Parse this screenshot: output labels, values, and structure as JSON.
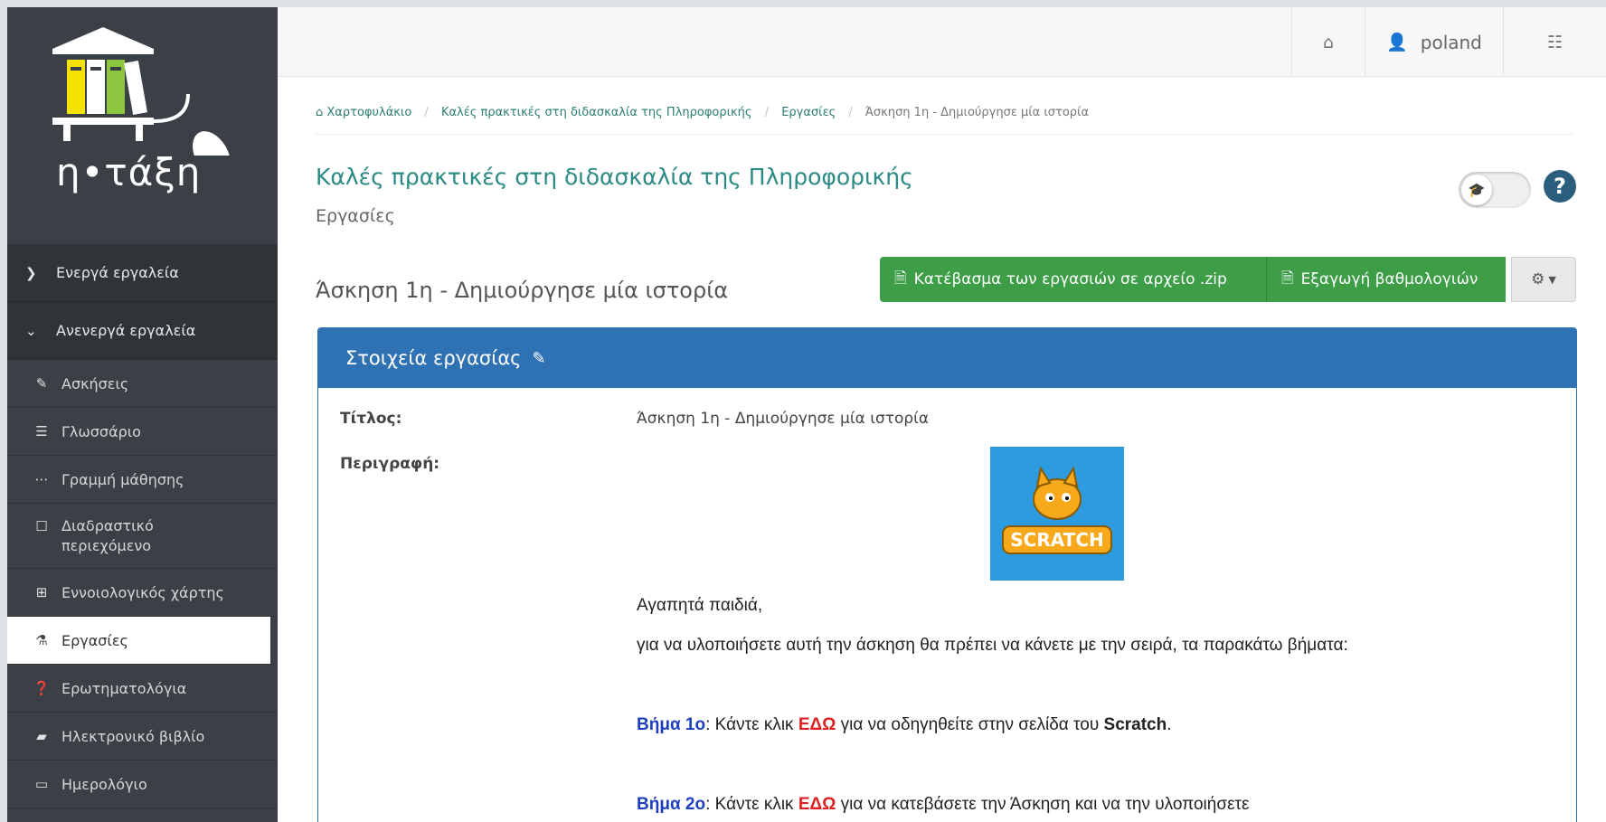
{
  "sidebar": {
    "logo_text": "η•τάξη",
    "active_tools": "Ενεργά εργαλεία",
    "inactive_tools": "Ανενεργά εργαλεία",
    "items": [
      {
        "label": "Ασκήσεις",
        "icon": "edit-icon"
      },
      {
        "label": "Γλωσσάριο",
        "icon": "list-icon"
      },
      {
        "label": "Γραμμή μάθησης",
        "icon": "ellipsis-icon"
      },
      {
        "label": "Διαδραστικό περιεχόμενο",
        "icon": "square-icon"
      },
      {
        "label": "Εννοιολογικός χάρτης",
        "icon": "sitemap-icon"
      },
      {
        "label": "Εργασίες",
        "icon": "flask-icon",
        "active": true
      },
      {
        "label": "Ερωτηματολόγια",
        "icon": "question-icon"
      },
      {
        "label": "Ηλεκτρονικό βιβλίο",
        "icon": "book-icon"
      },
      {
        "label": "Ημερολόγιο",
        "icon": "calendar-icon"
      }
    ]
  },
  "topbar": {
    "username": "poland"
  },
  "breadcrumb": {
    "items": [
      "Χαρτοφυλάκιο",
      "Καλές πρακτικές στη διδασκαλία της Πληροφορικής",
      "Εργασίες"
    ],
    "current": "Άσκηση 1η - Δημιούργησε μία ιστορία"
  },
  "course": {
    "title": "Καλές πρακτικές στη διδασκαλία της Πληροφορικής",
    "subtitle": "Εργασίες"
  },
  "assignment": {
    "title": "Άσκηση 1η - Δημιούργησε μία ιστορία",
    "download_label": "Κατέβασμα των εργασιών σε αρχείο .zip",
    "export_label": "Εξαγωγή βαθμολογιών"
  },
  "panel": {
    "heading": "Στοιχεία εργασίας",
    "title_label": "Τίτλος:",
    "title_value": "Άσκηση 1η - Δημιούργησε μία ιστορία",
    "desc_label": "Περιγραφή:",
    "scratch_logo_text": "SCRATCH",
    "greeting": "Αγαπητά παιδιά,",
    "intro": "για να υλοποιήσετε αυτή την άσκηση θα πρέπει να κάνετε με την σειρά, τα παρακάτω βήματα:",
    "step1_label": "Βήμα 1ο",
    "step1_pre": ": Κάντε κλικ ",
    "step1_link": "ΕΔΩ",
    "step1_post": " για να οδηγηθείτε στην σελίδα του ",
    "step1_bold": "Scratch",
    "step1_end": ".",
    "step2_label": "Βήμα 2ο",
    "step2_pre": ": Κάντε κλικ ",
    "step2_link": "ΕΔΩ",
    "step2_post": " για να κατεβάσετε την Άσκηση και να την υλοποιήσετε"
  },
  "colors": {
    "sidebar_bg": "#3a4046",
    "accent_teal": "#2b8a83",
    "panel_blue": "#2f72b3",
    "button_green": "#3d9e47",
    "step_blue": "#1d3fbd",
    "link_red": "#e02020"
  }
}
